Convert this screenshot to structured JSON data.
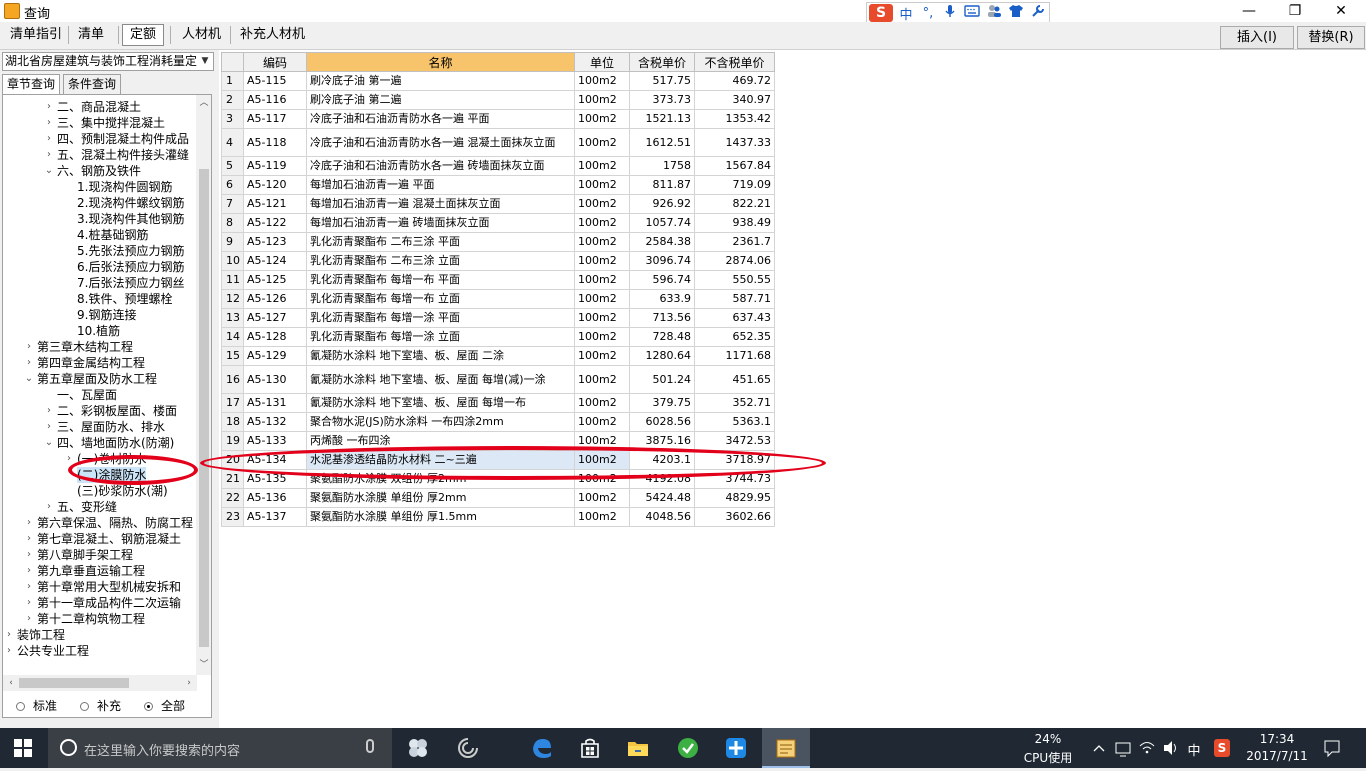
{
  "window": {
    "title": "查询",
    "minimize_glyph": "—",
    "maximize_glyph": "❐",
    "close_glyph": "✕"
  },
  "ime": {
    "logo": "S",
    "lang": "中",
    "punct": "°,",
    "icons": [
      "mic-icon",
      "keyboard-icon",
      "people-icon",
      "shirt-icon",
      "wrench-icon"
    ]
  },
  "toolbar": {
    "tabs": [
      "清单指引",
      "清单",
      "定额",
      "人材机",
      "补充人材机"
    ],
    "active_tab": "定额",
    "insert_label": "插入(I)",
    "replace_label": "替换(R)"
  },
  "left": {
    "library_select": "湖北省房屋建筑与装饰工程消耗量定",
    "tabs": [
      "章节查询",
      "条件查询"
    ],
    "tree": [
      {
        "label": "二、商品混凝土",
        "twisty": "›"
      },
      {
        "label": "三、集中搅拌混凝土",
        "twisty": "›"
      },
      {
        "label": "四、预制混凝土构件成品",
        "twisty": "›"
      },
      {
        "label": "五、混凝土构件接头灌缝",
        "twisty": "›"
      },
      {
        "label": "六、钢筋及铁件",
        "twisty": "⌄"
      },
      {
        "label": "1.现浇构件圆钢筋",
        "twisty": ""
      },
      {
        "label": "2.现浇构件螺纹钢筋",
        "twisty": ""
      },
      {
        "label": "3.现浇构件其他钢筋",
        "twisty": ""
      },
      {
        "label": "4.桩基础钢筋",
        "twisty": ""
      },
      {
        "label": "5.先张法预应力钢筋",
        "twisty": ""
      },
      {
        "label": "6.后张法预应力钢筋",
        "twisty": ""
      },
      {
        "label": "7.后张法预应力钢丝",
        "twisty": ""
      },
      {
        "label": "8.铁件、预埋螺栓",
        "twisty": ""
      },
      {
        "label": "9.钢筋连接",
        "twisty": ""
      },
      {
        "label": "10.植筋",
        "twisty": ""
      },
      {
        "label": "第三章木结构工程",
        "twisty": "›"
      },
      {
        "label": "第四章金属结构工程",
        "twisty": "›"
      },
      {
        "label": "第五章屋面及防水工程",
        "twisty": "⌄"
      },
      {
        "label": "一、瓦屋面",
        "twisty": ""
      },
      {
        "label": "二、彩钢板屋面、楼面",
        "twisty": "›"
      },
      {
        "label": "三、屋面防水、排水",
        "twisty": "›"
      },
      {
        "label": "四、墙地面防水(防潮)",
        "twisty": "⌄"
      },
      {
        "label": "(一)卷材防水",
        "twisty": "›"
      },
      {
        "label": "(二)涂膜防水",
        "twisty": ""
      },
      {
        "label": "(三)砂浆防水(潮)",
        "twisty": ""
      },
      {
        "label": "五、变形缝",
        "twisty": "›"
      },
      {
        "label": "第六章保温、隔热、防腐工程",
        "twisty": "›"
      },
      {
        "label": "第七章混凝土、钢筋混凝土",
        "twisty": "›"
      },
      {
        "label": "第八章脚手架工程",
        "twisty": "›"
      },
      {
        "label": "第九章垂直运输工程",
        "twisty": "›"
      },
      {
        "label": "第十章常用大型机械安拆和",
        "twisty": "›"
      },
      {
        "label": "第十一章成品构件二次运输",
        "twisty": "›"
      },
      {
        "label": "第十二章构筑物工程",
        "twisty": "›"
      },
      {
        "label": "装饰工程",
        "twisty": "›"
      },
      {
        "label": "公共专业工程",
        "twisty": "›"
      }
    ],
    "scroll_up": "︿",
    "scroll_down": "﹀",
    "scroll_left": "‹",
    "scroll_right": "›",
    "radios": [
      "标准",
      "补充",
      "全部"
    ],
    "radio_selected": "全部"
  },
  "grid": {
    "columns": [
      "",
      "编码",
      "名称",
      "单位",
      "含税单价",
      "不含税单价"
    ],
    "rows": [
      [
        "1",
        "A5-115",
        "刷冷底子油 第一遍",
        "100m2",
        "517.75",
        "469.72"
      ],
      [
        "2",
        "A5-116",
        "刷冷底子油 第二遍",
        "100m2",
        "373.73",
        "340.97"
      ],
      [
        "3",
        "A5-117",
        "冷底子油和石油沥青防水各一遍 平面",
        "100m2",
        "1521.13",
        "1353.42"
      ],
      [
        "4",
        "A5-118",
        "冷底子油和石油沥青防水各一遍 混凝土面抹灰立面",
        "100m2",
        "1612.51",
        "1437.33"
      ],
      [
        "5",
        "A5-119",
        "冷底子油和石油沥青防水各一遍 砖墙面抹灰立面",
        "100m2",
        "1758",
        "1567.84"
      ],
      [
        "6",
        "A5-120",
        "每增加石油沥青一遍 平面",
        "100m2",
        "811.87",
        "719.09"
      ],
      [
        "7",
        "A5-121",
        "每增加石油沥青一遍 混凝土面抹灰立面",
        "100m2",
        "926.92",
        "822.21"
      ],
      [
        "8",
        "A5-122",
        "每增加石油沥青一遍 砖墙面抹灰立面",
        "100m2",
        "1057.74",
        "938.49"
      ],
      [
        "9",
        "A5-123",
        "乳化沥青聚酯布 二布三涂 平面",
        "100m2",
        "2584.38",
        "2361.7"
      ],
      [
        "10",
        "A5-124",
        "乳化沥青聚酯布 二布三涂 立面",
        "100m2",
        "3096.74",
        "2874.06"
      ],
      [
        "11",
        "A5-125",
        "乳化沥青聚酯布 每增一布 平面",
        "100m2",
        "596.74",
        "550.55"
      ],
      [
        "12",
        "A5-126",
        "乳化沥青聚酯布 每增一布 立面",
        "100m2",
        "633.9",
        "587.71"
      ],
      [
        "13",
        "A5-127",
        "乳化沥青聚酯布 每增一涂 平面",
        "100m2",
        "713.56",
        "637.43"
      ],
      [
        "14",
        "A5-128",
        "乳化沥青聚酯布 每增一涂 立面",
        "100m2",
        "728.48",
        "652.35"
      ],
      [
        "15",
        "A5-129",
        "氰凝防水涂料 地下室墙、板、屋面 二涂",
        "100m2",
        "1280.64",
        "1171.68"
      ],
      [
        "16",
        "A5-130",
        "氰凝防水涂料 地下室墙、板、屋面 每增(减)一涂",
        "100m2",
        "501.24",
        "451.65"
      ],
      [
        "17",
        "A5-131",
        "氰凝防水涂料 地下室墙、板、屋面 每增一布",
        "100m2",
        "379.75",
        "352.71"
      ],
      [
        "18",
        "A5-132",
        "聚合物水泥(JS)防水涂料 一布四涂2mm",
        "100m2",
        "6028.56",
        "5363.1"
      ],
      [
        "19",
        "A5-133",
        "丙烯酸 一布四涂",
        "100m2",
        "3875.16",
        "3472.53"
      ],
      [
        "20",
        "A5-134",
        "水泥基渗透结晶防水材料 二~三遍",
        "100m2",
        "4203.1",
        "3718.97"
      ],
      [
        "21",
        "A5-135",
        "聚氨酯防水涂膜 双组份 厚2mm",
        "100m2",
        "4192.08",
        "3744.73"
      ],
      [
        "22",
        "A5-136",
        "聚氨酯防水涂膜 单组份 厚2mm",
        "100m2",
        "5424.48",
        "4829.95"
      ],
      [
        "23",
        "A5-137",
        "聚氨酯防水涂膜 单组份 厚1.5mm",
        "100m2",
        "4048.56",
        "3602.66"
      ]
    ],
    "highlighted_row": "20"
  },
  "annotations": {
    "color": "#e3001a"
  },
  "taskbar": {
    "search_placeholder": "在这里输入你要搜索的内容",
    "cpu_percent": "24%",
    "cpu_label": "CPU使用",
    "ime_lang": "中",
    "ime_logo": "S",
    "time": "17:34",
    "date": "2017/7/11",
    "app_icons": [
      "task-view-icon",
      "cortana-ring-icon",
      "edge-icon",
      "store-icon",
      "file-explorer-icon",
      "green-app-icon",
      "blue-app-icon",
      "quota-app-icon"
    ]
  }
}
